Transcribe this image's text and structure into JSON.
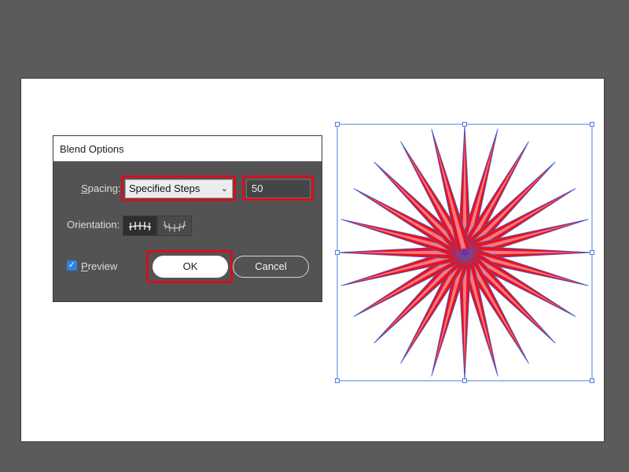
{
  "dialog": {
    "title": "Blend Options",
    "spacing": {
      "label_underlined": "S",
      "label_rest": "pacing:",
      "selected": "Specified Steps",
      "steps_value": "50"
    },
    "orientation": {
      "label": "Orientation:",
      "options": [
        "align-to-page-icon",
        "align-to-path-icon"
      ],
      "selected": "align-to-page-icon"
    },
    "preview": {
      "label_underlined": "P",
      "label_rest": "review",
      "checked": true
    },
    "ok_label": "OK",
    "cancel_label": "Cancel"
  },
  "artwork": {
    "shape": "starburst-blend",
    "spikes": 24,
    "fill_colors": [
      "#e8121f",
      "#ffffff"
    ],
    "outline_color": "#3a5fd0",
    "center_color": "#7a2a9a",
    "selection_color": "#4a7fe0"
  },
  "highlight_color": "#d40f1f"
}
